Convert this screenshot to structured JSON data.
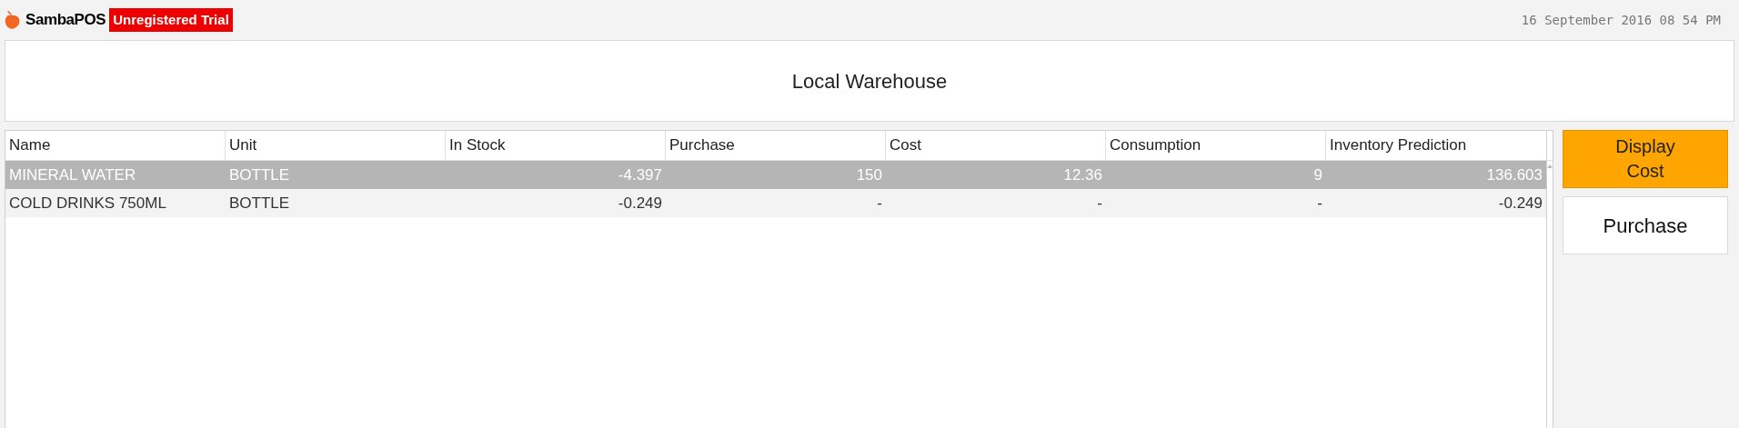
{
  "app": {
    "name": "SambaPOS",
    "badge": "Unregistered Trial",
    "datetime": "16 September 2016 08 54 PM"
  },
  "header": {
    "title": "Local Warehouse"
  },
  "table": {
    "columns": [
      {
        "label": "Name",
        "kind": "text"
      },
      {
        "label": "Unit",
        "kind": "text"
      },
      {
        "label": "In Stock",
        "kind": "number"
      },
      {
        "label": "Purchase",
        "kind": "number"
      },
      {
        "label": "Cost",
        "kind": "number"
      },
      {
        "label": "Consumption",
        "kind": "number"
      },
      {
        "label": "Inventory Prediction",
        "kind": "number"
      }
    ],
    "rows": [
      {
        "selected": true,
        "cells": [
          "MINERAL WATER",
          "BOTTLE",
          "-4.397",
          "150",
          "12.36",
          "9",
          "136.603"
        ]
      },
      {
        "selected": false,
        "cells": [
          "COLD DRINKS 750ML",
          "BOTTLE",
          "-0.249",
          "-",
          "-",
          "-",
          "-0.249"
        ]
      }
    ]
  },
  "buttons": [
    {
      "label": "Display\nCost",
      "selected": true
    },
    {
      "label": "Purchase",
      "selected": false
    }
  ]
}
